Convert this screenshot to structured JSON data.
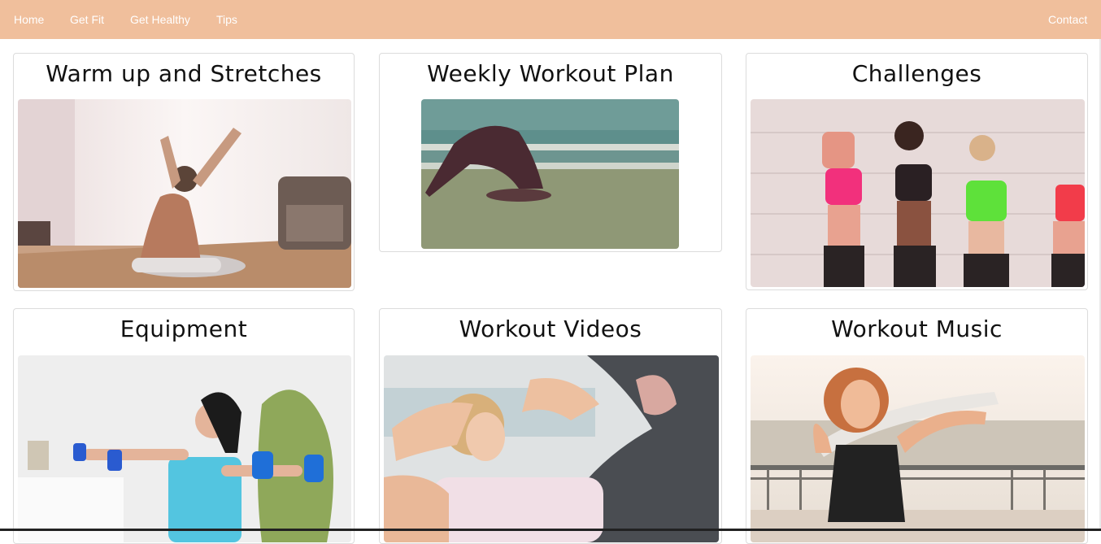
{
  "nav": {
    "left": [
      {
        "label": "Home"
      },
      {
        "label": "Get Fit"
      },
      {
        "label": "Get Healthy"
      },
      {
        "label": "Tips"
      }
    ],
    "right": {
      "label": "Contact"
    }
  },
  "cards": [
    {
      "title": "Warm up and Stretches"
    },
    {
      "title": "Weekly Workout Plan"
    },
    {
      "title": "Challenges"
    },
    {
      "title": "Equipment"
    },
    {
      "title": "Workout Videos"
    },
    {
      "title": "Workout Music"
    }
  ],
  "colors": {
    "navbar": "#f0bf9c",
    "nav_text": "#ffffff",
    "card_border": "#dcdcdc"
  }
}
